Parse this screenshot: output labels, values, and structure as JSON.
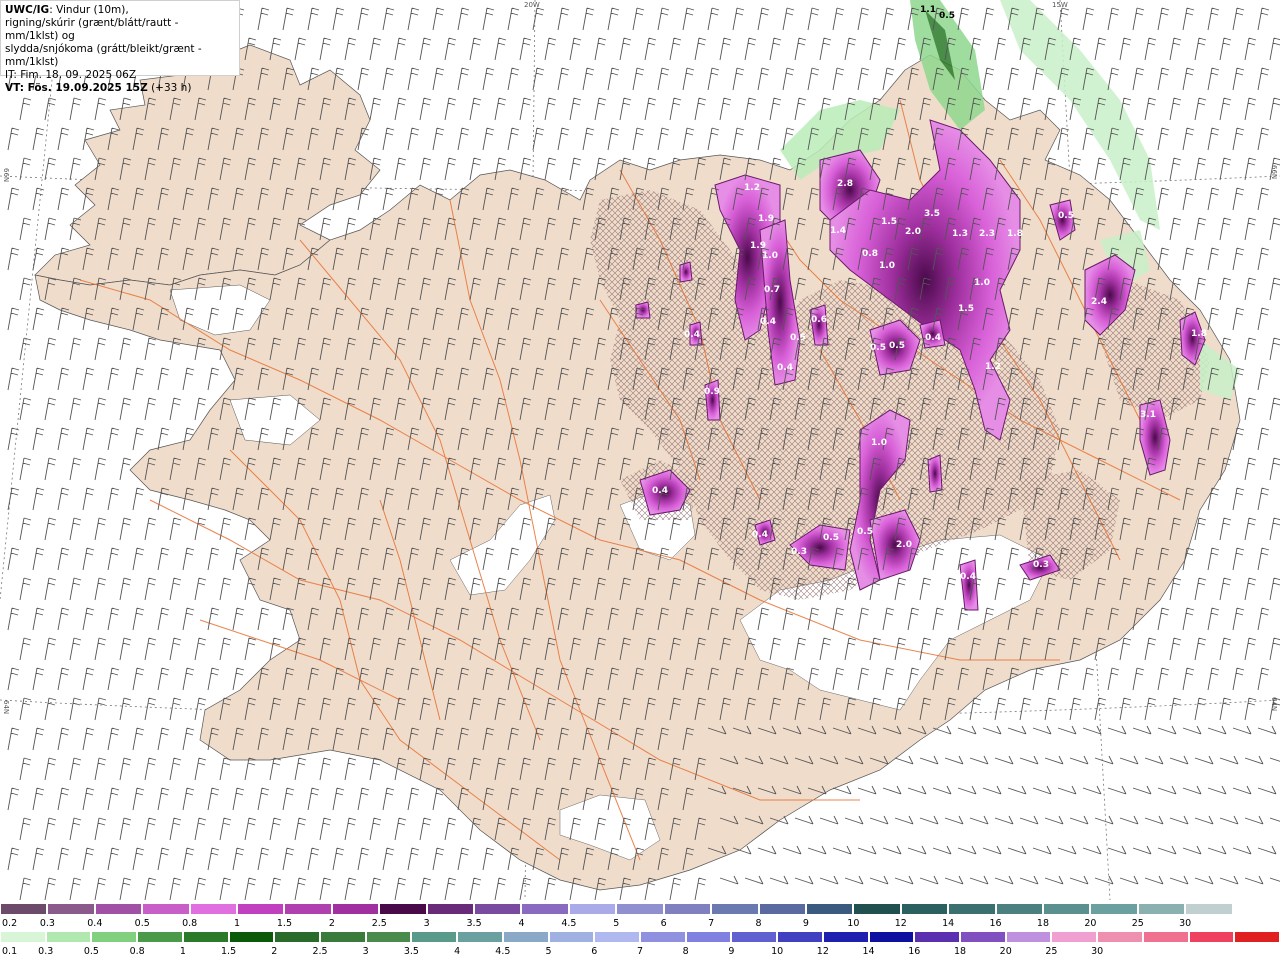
{
  "header": {
    "model": "UWC/IG",
    "desc1": ": Vindur (10m),",
    "desc2": "rigning/skúrir (grænt/blátt/rautt - mm/1klst) og",
    "desc3": "slydda/snjókoma (grátt/bleikt/grænt - mm/1klst)",
    "it": "IT: Fim. 18. 09. 2025 06Z",
    "vt_label": "VT: Fös. 19.09.2025 15Z",
    "vt_offset": " (+33 h)"
  },
  "graticule": {
    "lon20": "20W",
    "lon15": "15W",
    "lat66_left": "66N",
    "lat66_right": "66N",
    "lat64_left": "64N",
    "lat64_right": "64N"
  },
  "precip_labels": [
    "2.8",
    "1.2",
    "1.9",
    "1.0",
    "1.9",
    "0.7",
    "0.4",
    "0.4",
    "0.5",
    "1.4",
    "1.5",
    "2.0",
    "3.5",
    "1.3",
    "2.3",
    "1.8",
    "0.8",
    "1.0",
    "1.0",
    "1.5",
    "1.2",
    "0.5",
    "0.5",
    "0.4",
    "0.6",
    "0.4",
    "0.9",
    "1.0",
    "0.4",
    "0.4",
    "0.3",
    "0.5",
    "0.5",
    "2.0",
    "0.4",
    "0.3",
    "2.4",
    "1.8",
    "3.1",
    "0.5",
    "1.1",
    "0.5"
  ],
  "legend_top": {
    "colors": [
      "#6b4a6b",
      "#8a5a8a",
      "#a050a5",
      "#c85fc8",
      "#e070e0",
      "#c040c0",
      "#b040b0",
      "#a030a0",
      "#4a0a4a",
      "#6a2a7a",
      "#7a4aa0",
      "#8a6ac0",
      "#aaaae8",
      "#9090d0",
      "#8080c0",
      "#6a7ab0",
      "#5a6aa0",
      "#3a5a80",
      "#205050",
      "#2a6060",
      "#3a7070",
      "#4a8080",
      "#5a9090",
      "#6aa0a0",
      "#8ab0b0",
      "#c0d0d0",
      "#ffffff"
    ],
    "labels": [
      "0.2",
      "0.3",
      "0.4",
      "0.5",
      "0.8",
      "1",
      "1.5",
      "2",
      "2.5",
      "3",
      "3.5",
      "4",
      "4.5",
      "5",
      "6",
      "7",
      "8",
      "9",
      "10",
      "12",
      "14",
      "16",
      "18",
      "20",
      "25",
      "30"
    ]
  },
  "legend_bottom": {
    "colors": [
      "#d8f5d8",
      "#b0e8b0",
      "#80d080",
      "#4a9a4a",
      "#2a7a2a",
      "#0a5a0a",
      "#2a6a2a",
      "#3a7a3a",
      "#4a8a4a",
      "#5a9a8a",
      "#6aa0a0",
      "#8aa8c8",
      "#a0b0e0",
      "#b0b8f0",
      "#9090e0",
      "#8080e0",
      "#6060d0",
      "#4040c0",
      "#2020b0",
      "#1010a0",
      "#5a30b0",
      "#8050c0",
      "#c090e0",
      "#f0a0d0",
      "#f090b0",
      "#f07090",
      "#f04060",
      "#e02020"
    ],
    "labels": [
      "0.1",
      "0.3",
      "0.5",
      "0.8",
      "1",
      "1.5",
      "2",
      "2.5",
      "3",
      "3.5",
      "4",
      "4.5",
      "5",
      "6",
      "7",
      "8",
      "9",
      "10",
      "12",
      "14",
      "16",
      "18",
      "20",
      "25",
      "30"
    ]
  },
  "colors": {
    "land": "#f0dccb",
    "roads": "#e8773a",
    "hatch": "#7a5a5a",
    "snow_purple": "#c24fc2",
    "rain_green": "#8fd88f"
  }
}
